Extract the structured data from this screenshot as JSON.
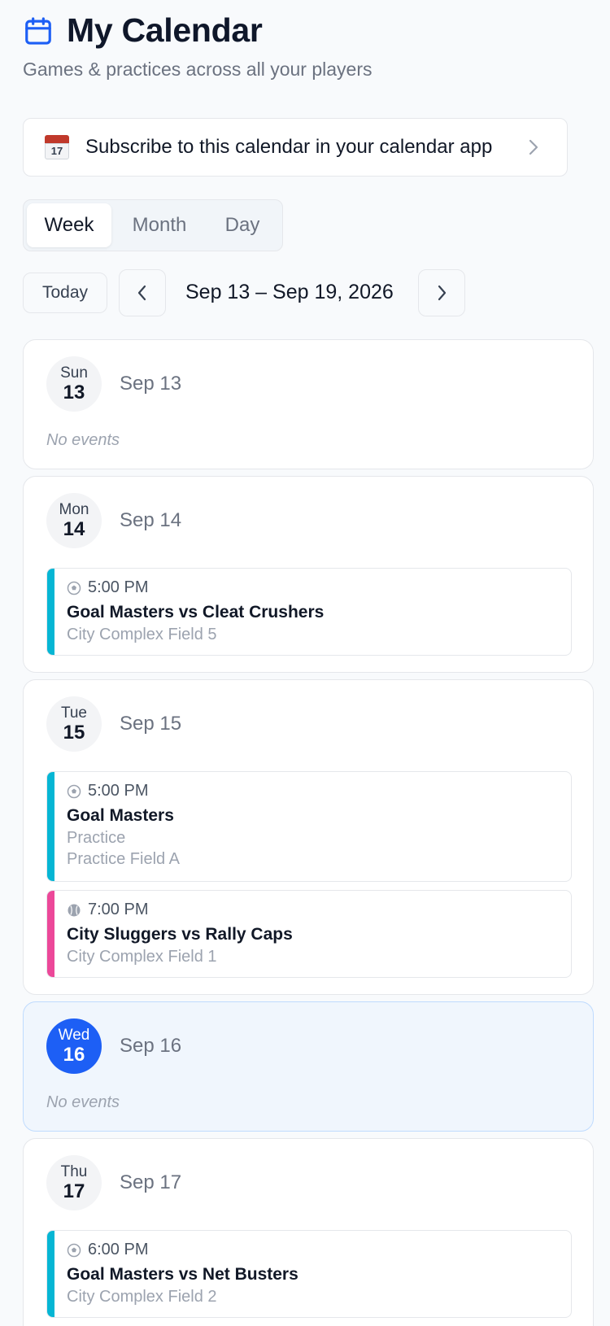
{
  "header": {
    "title": "My Calendar",
    "subtitle": "Games & practices across all your players",
    "icon": "calendar-icon",
    "accent": "#1d5ff5"
  },
  "subscribe": {
    "emoji_day": "17",
    "label": "Subscribe to this calendar in your calendar app"
  },
  "view_tabs": [
    {
      "label": "Week",
      "active": true
    },
    {
      "label": "Month",
      "active": false
    },
    {
      "label": "Day",
      "active": false
    }
  ],
  "nav": {
    "today_label": "Today",
    "range": "Sep 13 – Sep 19, 2026"
  },
  "no_events_label": "No events",
  "colors": {
    "soccer": "#06b6d4",
    "baseball": "#ec4899",
    "today": "#1d5ff5"
  },
  "days": [
    {
      "dow": "Sun",
      "num": "13",
      "date": "Sep 13",
      "today": false,
      "events": []
    },
    {
      "dow": "Mon",
      "num": "14",
      "date": "Sep 14",
      "today": false,
      "events": [
        {
          "sport": "soccer",
          "time": "5:00 PM",
          "title": "Goal Masters vs Cleat Crushers",
          "lines": [
            "City Complex Field 5"
          ]
        }
      ]
    },
    {
      "dow": "Tue",
      "num": "15",
      "date": "Sep 15",
      "today": false,
      "events": [
        {
          "sport": "soccer",
          "time": "5:00 PM",
          "title": "Goal Masters",
          "lines": [
            "Practice",
            "Practice Field A"
          ]
        },
        {
          "sport": "baseball",
          "time": "7:00 PM",
          "title": "City Sluggers vs Rally Caps",
          "lines": [
            "City Complex Field 1"
          ]
        }
      ]
    },
    {
      "dow": "Wed",
      "num": "16",
      "date": "Sep 16",
      "today": true,
      "events": []
    },
    {
      "dow": "Thu",
      "num": "17",
      "date": "Sep 17",
      "today": false,
      "events": [
        {
          "sport": "soccer",
          "time": "6:00 PM",
          "title": "Goal Masters vs Net Busters",
          "lines": [
            "City Complex Field 2"
          ]
        }
      ]
    }
  ]
}
